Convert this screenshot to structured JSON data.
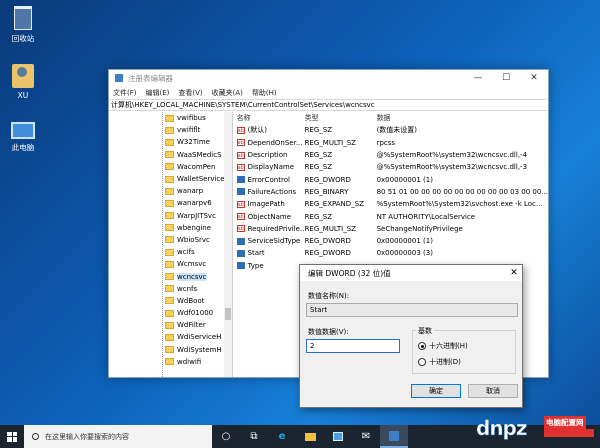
{
  "desktop": {
    "icons": [
      {
        "label": "回收站",
        "icon": "recycle-bin-icon"
      },
      {
        "label": "XU",
        "icon": "user-folder-icon"
      },
      {
        "label": "此电脑",
        "icon": "this-pc-icon"
      }
    ]
  },
  "regedit": {
    "title": "注册表编辑器",
    "menu": [
      "文件(F)",
      "编辑(E)",
      "查看(V)",
      "收藏夹(A)",
      "帮助(H)"
    ],
    "address": "计算机\\HKEY_LOCAL_MACHINE\\SYSTEM\\CurrentControlSet\\Services\\wcncsvc",
    "tree": [
      "vwifibus",
      "vwififlt",
      "W32Time",
      "WaaSMedicS",
      "WacomPen",
      "WalletService",
      "wanarp",
      "wanarpv6",
      "WarpJITSvc",
      "wbengine",
      "WbioSrvc",
      "wcifs",
      "Wcmsvc",
      "wcncsvc",
      "wcnfs",
      "WdBoot",
      "Wdf01000",
      "WdFilter",
      "WdiServiceH",
      "WdiSystemH",
      "wdiwifi"
    ],
    "tree_selected": "wcncsvc",
    "columns": {
      "name": "名称",
      "type": "类型",
      "data": "数据"
    },
    "values": [
      {
        "name": "(默认)",
        "type": "REG_SZ",
        "data": "(数值未设置)",
        "icon": "string"
      },
      {
        "name": "DependOnSer...",
        "type": "REG_MULTI_SZ",
        "data": "rpcss",
        "icon": "string"
      },
      {
        "name": "Description",
        "type": "REG_SZ",
        "data": "@%SystemRoot%\\system32\\wcncsvc.dll,-4",
        "icon": "string"
      },
      {
        "name": "DisplayName",
        "type": "REG_SZ",
        "data": "@%SystemRoot%\\system32\\wcncsvc.dll,-3",
        "icon": "string"
      },
      {
        "name": "ErrorControl",
        "type": "REG_DWORD",
        "data": "0x00000001 (1)",
        "icon": "binary"
      },
      {
        "name": "FailureActions",
        "type": "REG_BINARY",
        "data": "80 51 01 00 00 00 00 00 00 00 00 00 03 00 00...",
        "icon": "binary"
      },
      {
        "name": "ImagePath",
        "type": "REG_EXPAND_SZ",
        "data": "%SystemRoot%\\System32\\svchost.exe -k Loc...",
        "icon": "string"
      },
      {
        "name": "ObjectName",
        "type": "REG_SZ",
        "data": "NT AUTHORITY\\LocalService",
        "icon": "string"
      },
      {
        "name": "RequiredPrivile...",
        "type": "REG_MULTI_SZ",
        "data": "SeChangeNotifyPrivilege",
        "icon": "string"
      },
      {
        "name": "ServiceSidType",
        "type": "REG_DWORD",
        "data": "0x00000001 (1)",
        "icon": "binary"
      },
      {
        "name": "Start",
        "type": "REG_DWORD",
        "data": "0x00000003 (3)",
        "icon": "binary"
      },
      {
        "name": "Type",
        "type": "",
        "data": "",
        "icon": "binary"
      }
    ]
  },
  "dialog": {
    "title": "编辑 DWORD (32 位)值",
    "name_label": "数值名称(N):",
    "name_value": "Start",
    "data_label": "数值数据(V):",
    "data_value": "2",
    "base_label": "基数",
    "base_options": [
      "十六进制(H)",
      "十进制(D)"
    ],
    "base_selected": "十六进制(H)",
    "ok": "确定",
    "cancel": "取消"
  },
  "taskbar": {
    "search_placeholder": "在这里输入你要搜索的内容"
  },
  "watermark": {
    "text": "dnpz",
    "sub": "电脑配置网"
  }
}
